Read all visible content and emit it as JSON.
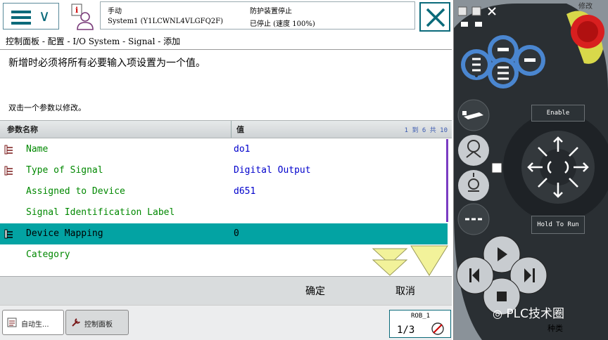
{
  "status": {
    "mode": "手动",
    "system": "System1 (Y1LCWNL4VLGFQ2F)",
    "protection": "防护装置停止",
    "state": "已停止 (速度 100%)"
  },
  "breadcrumb": "控制面板 - 配置 - I/O System - Signal - 添加",
  "instructions": {
    "line1": "新增时必须将所有必要输入项设置为一个值。",
    "line2": "双击一个参数以修改。"
  },
  "table": {
    "col_name": "参数名称",
    "col_value": "值",
    "counter": "1 到 6 共 10",
    "rows": [
      {
        "name": "Name",
        "value": "do1",
        "icon": "param-icon"
      },
      {
        "name": "Type of Signal",
        "value": "Digital Output",
        "icon": "param-icon"
      },
      {
        "name": "Assigned to Device",
        "value": "d651",
        "icon": ""
      },
      {
        "name": "Signal Identification Label",
        "value": "",
        "icon": ""
      },
      {
        "name": "Device Mapping",
        "value": "0",
        "icon": "param-icon",
        "selected": true
      },
      {
        "name": "Category",
        "value": "",
        "icon": ""
      }
    ]
  },
  "buttons": {
    "ok": "确定",
    "cancel": "取消"
  },
  "taskbar": {
    "task1": "自动生...",
    "task2": "控制面板",
    "rob": "ROB_1",
    "fraction": "1/3"
  },
  "pendant": {
    "enable_label": "Enable",
    "hold_label": "Hold To Run"
  },
  "watermark": {
    "text": "PLC技术圈",
    "sub": "种类",
    "edge": "修改"
  },
  "colors": {
    "accent": "#03A3A3",
    "param_name": "#008800",
    "param_value": "#0000CC",
    "brand": "#0A6A7A"
  }
}
